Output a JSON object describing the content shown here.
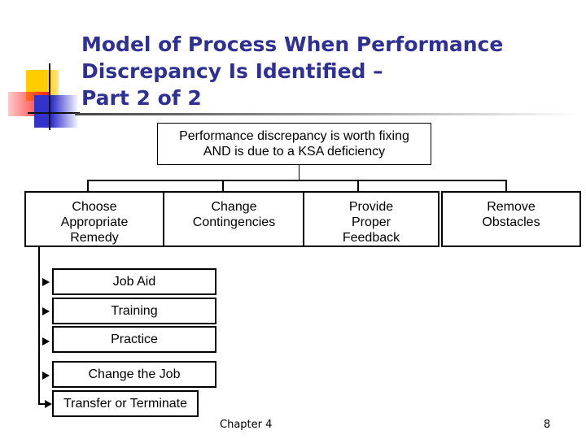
{
  "slide": {
    "title_lines": [
      "Model of Process When Performance",
      "Discrepancy Is Identified –",
      "Part 2 of 2"
    ],
    "title_color": "#2e3192"
  },
  "diagram": {
    "header": [
      "Performance discrepancy is worth fixing",
      "AND is due to a KSA deficiency"
    ],
    "categories": [
      {
        "lines": [
          "Choose",
          "Appropriate",
          "Remedy"
        ]
      },
      {
        "lines": [
          "Change",
          "Contingencies"
        ]
      },
      {
        "lines": [
          "Provide",
          "Proper",
          "Feedback"
        ]
      },
      {
        "lines": [
          "Remove",
          "Obstacles"
        ]
      }
    ],
    "remedies": [
      "Job Aid",
      "Training",
      "Practice",
      "Change the Job",
      "Transfer or Terminate"
    ]
  },
  "footer": {
    "chapter": "Chapter 4",
    "page_number": "8"
  }
}
